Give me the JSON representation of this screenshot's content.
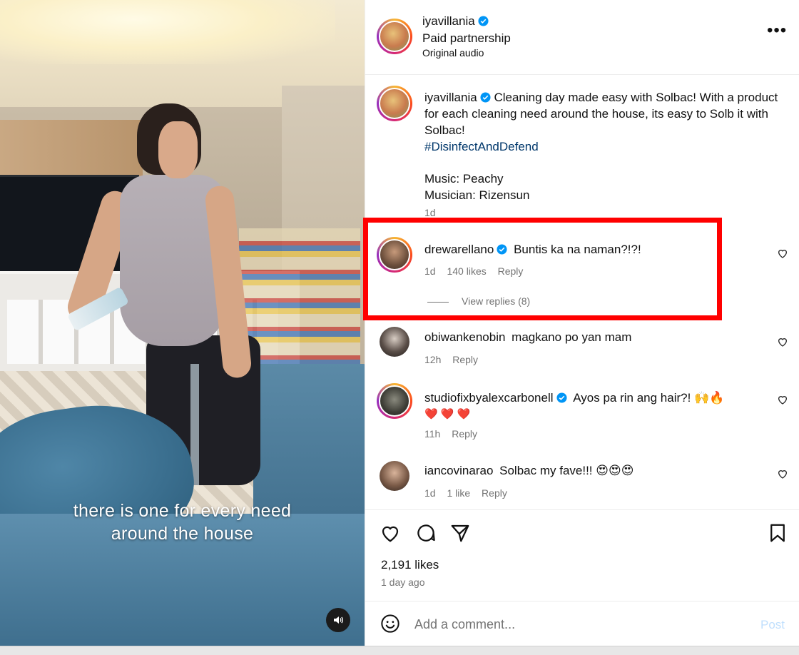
{
  "video": {
    "caption_line1": "there is one for every need",
    "caption_line2": "around the house"
  },
  "post": {
    "author": "iyavillania",
    "subtitle": "Paid partnership",
    "audio": "Original audio",
    "caption": {
      "author": "iyavillania",
      "text": "Cleaning day made easy with Solbac! With a product for each cleaning need around the house, its easy to Solb it with Solbac!",
      "hashtag": "#DisinfectAndDefend",
      "music_line": "Music: Peachy",
      "musician_line": "Musician: Rizensun",
      "time": "1d"
    },
    "comments": [
      {
        "user": "drewarellano",
        "verified": true,
        "text": "Buntis ka na naman?!?!",
        "time": "1d",
        "likes": "140 likes",
        "reply": "Reply",
        "view_replies": "View replies (8)"
      },
      {
        "user": "obiwankenobin",
        "verified": false,
        "text": "magkano po yan mam",
        "time": "12h",
        "reply": "Reply"
      },
      {
        "user": "studiofixbyalexcarbonell",
        "verified": true,
        "text": "Ayos pa rin ang hair?! 🙌🔥",
        "text2": "❤️ ❤️ ❤️",
        "time": "11h",
        "reply": "Reply"
      },
      {
        "user": "iancovinarao",
        "verified": false,
        "text": "Solbac my fave!!! 😍😍😍",
        "time": "1d",
        "likes": "1 like",
        "reply": "Reply"
      }
    ],
    "likes": "2,191 likes",
    "ago": "1 day ago",
    "add_comment_placeholder": "Add a comment...",
    "post_label": "Post"
  },
  "colors": {
    "highlight": "#ff0000",
    "verified": "#0095f6",
    "hashtag": "#00376b",
    "muted": "#737373",
    "post_disabled": "#c0dffd"
  }
}
